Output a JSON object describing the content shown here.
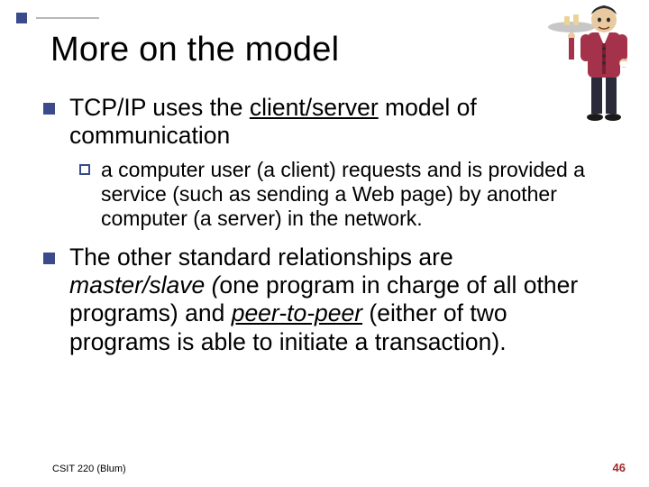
{
  "slide": {
    "title": "More on the model",
    "bullets": [
      {
        "level": 1,
        "parts": {
          "pre": "TCP/IP uses the ",
          "ul": "client/server",
          "post": " model of communication"
        }
      },
      {
        "level": 2,
        "text": "a computer user (a client) requests and is provided a service (such as sending a Web page) by another computer (a server) in the network."
      },
      {
        "level": 1,
        "parts": {
          "a": "The other standard relationships are ",
          "b_italic": "master/slave (",
          "c": "one program in charge of all other programs) and ",
          "d_ul_it": "peer-to-peer",
          "e": " (either of two programs is able to initiate a transaction)."
        }
      }
    ],
    "footer_left": "CSIT 220 (Blum)",
    "footer_right": "46",
    "image_alt": "waiter-illustration"
  }
}
